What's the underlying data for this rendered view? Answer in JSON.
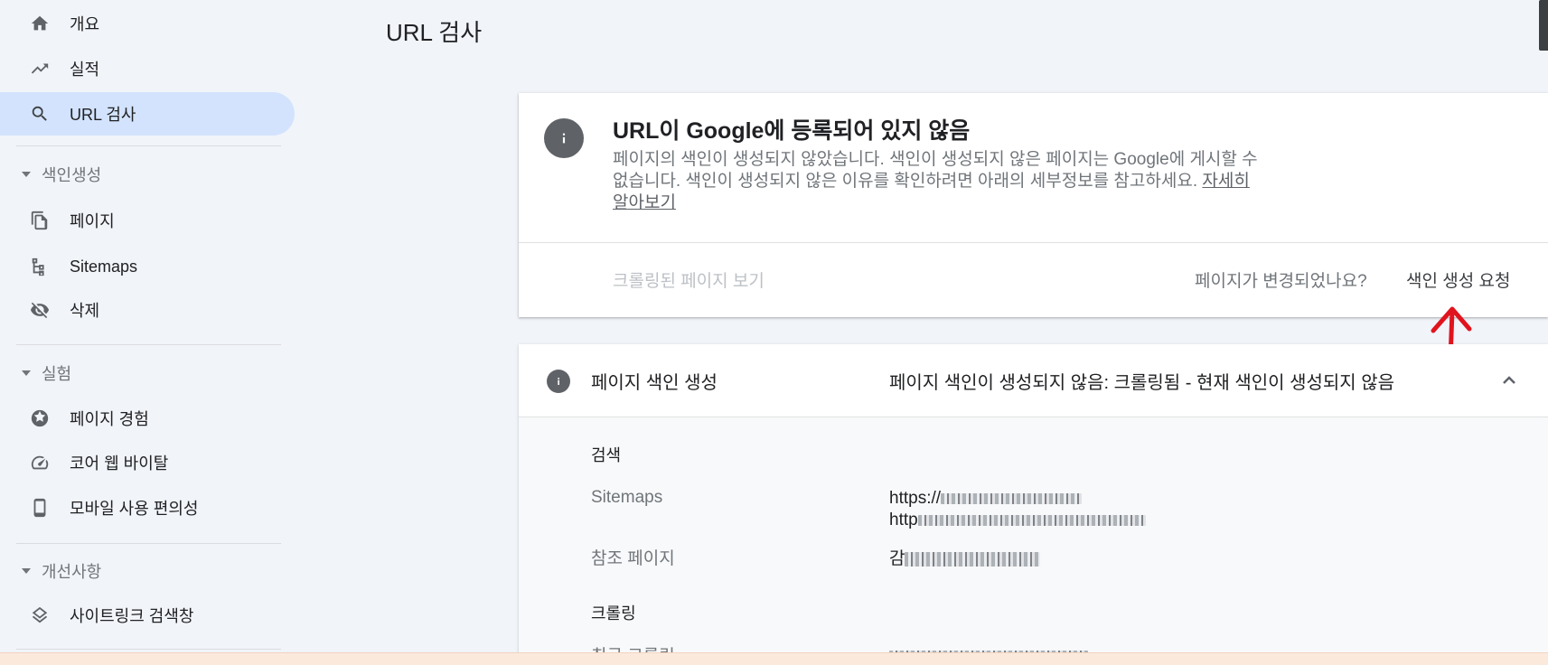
{
  "sidebar": {
    "items": [
      {
        "label": "개요",
        "icon": "home-icon"
      },
      {
        "label": "실적",
        "icon": "trending-up-icon"
      },
      {
        "label": "URL 검사",
        "icon": "search-icon"
      }
    ],
    "sections": [
      {
        "title": "색인생성",
        "items": [
          {
            "label": "페이지",
            "icon": "pages-icon"
          },
          {
            "label": "Sitemaps",
            "icon": "sitemap-icon"
          },
          {
            "label": "삭제",
            "icon": "eye-off-icon"
          }
        ]
      },
      {
        "title": "실험",
        "items": [
          {
            "label": "페이지 경험",
            "icon": "page-experience-icon"
          },
          {
            "label": "코어 웹 바이탈",
            "icon": "speedometer-icon"
          },
          {
            "label": "모바일 사용 편의성",
            "icon": "smartphone-icon"
          }
        ]
      },
      {
        "title": "개선사항",
        "items": [
          {
            "label": "사이트링크 검색창",
            "icon": "layers-icon"
          }
        ]
      }
    ]
  },
  "header": {
    "title": "URL 검사"
  },
  "status_card": {
    "title": "URL이 Google에 등록되어 있지 않음",
    "description": "페이지의 색인이 생성되지 않았습니다. 색인이 생성되지 않은 페이지는 Google에 게시할 수 없습니다. 색인이 생성되지 않은 이유를 확인하려면 아래의 세부정보를 참고하세요.",
    "learn_more": "자세히 알아보기",
    "view_crawled": "크롤링된 페이지 보기",
    "changed_question": "페이지가 변경되었나요?",
    "request_indexing": "색인 생성 요청"
  },
  "indexing_panel": {
    "title": "페이지 색인 생성",
    "status": "페이지 색인이 생성되지 않음: 크롤링됨 - 현재 색인이 생성되지 않음",
    "discovery_heading": "검색",
    "sitemaps_label": "Sitemaps",
    "sitemap_1_prefix": "https://",
    "sitemap_2_prefix": "http",
    "referring_label": "참조 페이지",
    "referring_value_prefix": "감",
    "crawl_heading": "크롤링",
    "last_crawl_label": "최근 크롤링"
  },
  "colors": {
    "accent_selected": "#d3e3fd",
    "arrow": "#e0141e"
  }
}
